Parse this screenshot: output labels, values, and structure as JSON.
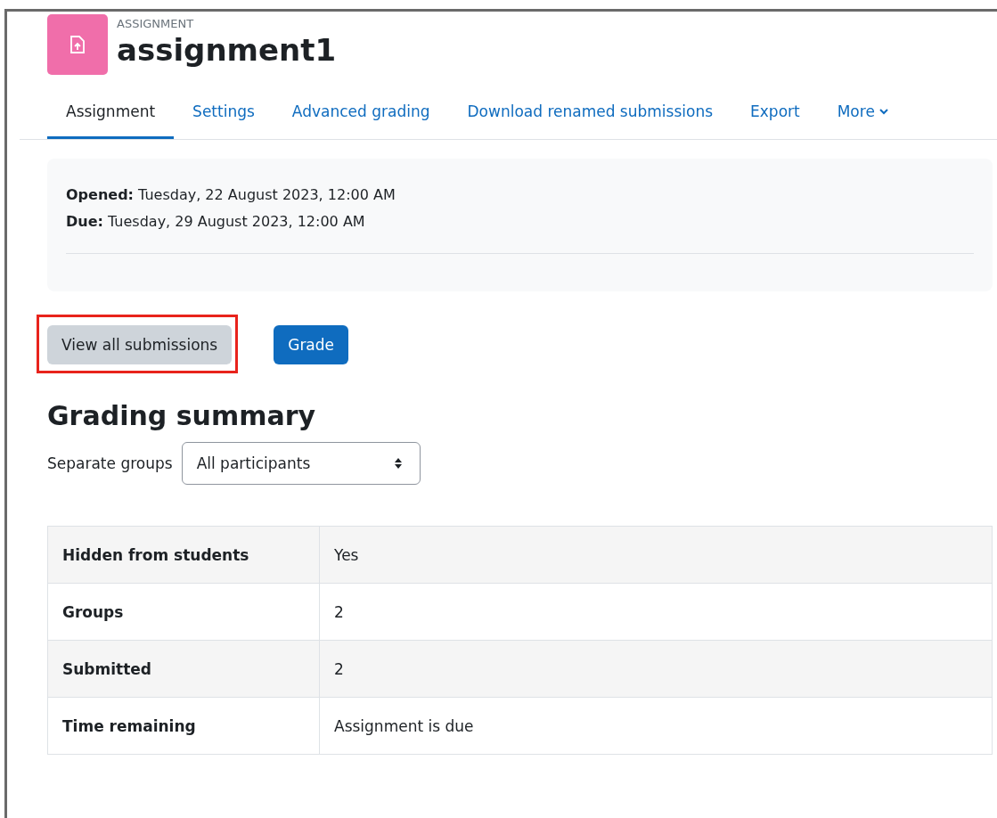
{
  "header": {
    "eyebrow": "ASSIGNMENT",
    "title": "assignment1"
  },
  "tabs": [
    {
      "label": "Assignment",
      "selected": true,
      "menu": false
    },
    {
      "label": "Settings",
      "selected": false,
      "menu": false
    },
    {
      "label": "Advanced grading",
      "selected": false,
      "menu": false
    },
    {
      "label": "Download renamed submissions",
      "selected": false,
      "menu": false
    },
    {
      "label": "Export",
      "selected": false,
      "menu": false
    },
    {
      "label": "More",
      "selected": false,
      "menu": true
    }
  ],
  "dates": [
    {
      "label": "Opened:",
      "value": "Tuesday, 22 August 2023, 12:00 AM"
    },
    {
      "label": "Due:",
      "value": "Tuesday, 29 August 2023, 12:00 AM"
    }
  ],
  "buttons": [
    {
      "label": "View all submissions",
      "kind": "secondary",
      "highlighted": true
    },
    {
      "label": "Grade",
      "kind": "primary",
      "highlighted": false
    }
  ],
  "summary": {
    "heading": "Grading summary",
    "group_label": "Separate groups",
    "group_value": "All participants",
    "rows": [
      {
        "label": "Hidden from students",
        "value": "Yes"
      },
      {
        "label": "Groups",
        "value": "2"
      },
      {
        "label": "Submitted",
        "value": "2"
      },
      {
        "label": "Time remaining",
        "value": "Assignment is due"
      }
    ]
  }
}
